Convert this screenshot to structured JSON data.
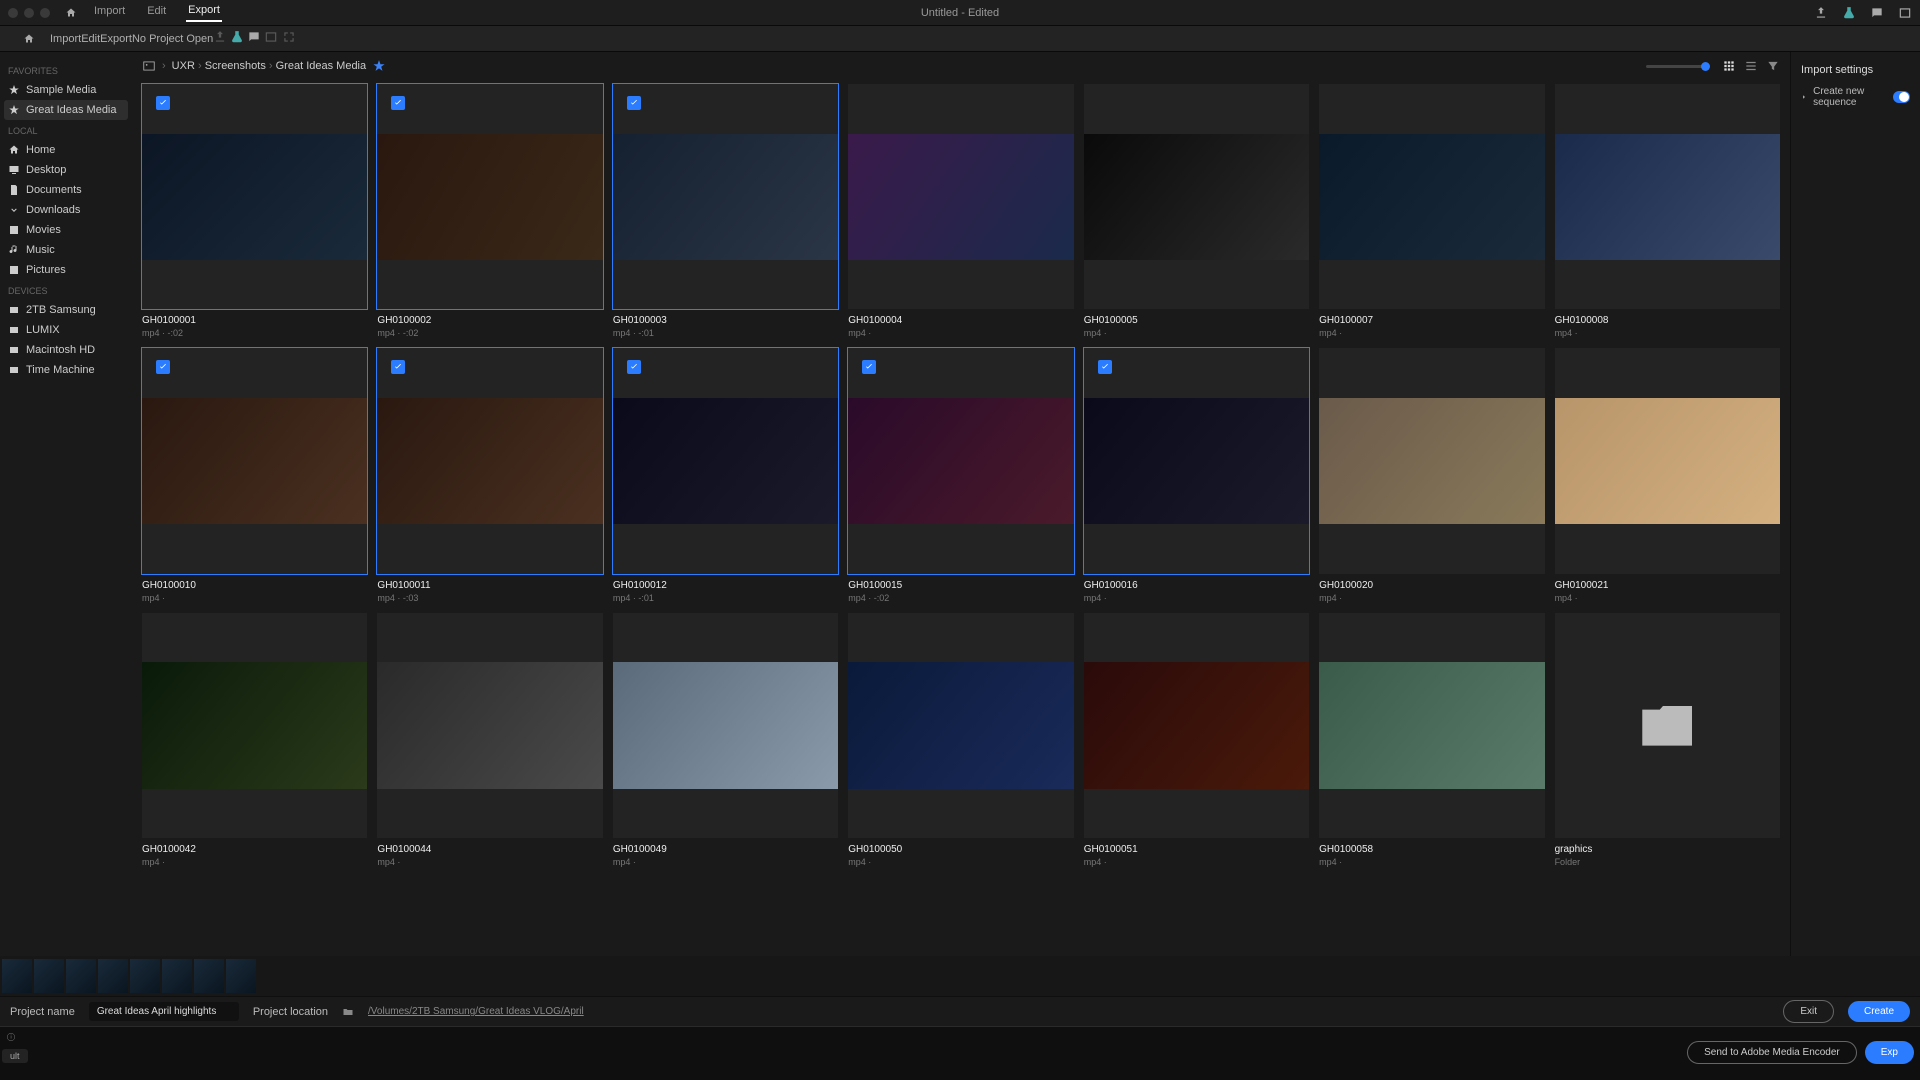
{
  "titlebar1": {
    "tabs": [
      "Import",
      "Edit",
      "Export"
    ],
    "active_index": 2,
    "center": "Untitled - Edited"
  },
  "titlebar2": {
    "tabs": [
      "Import",
      "Edit",
      "Export"
    ],
    "active_index": 0,
    "center": "No Project Open"
  },
  "sidebar": {
    "sections": [
      {
        "label": "FAVORITES",
        "items": [
          {
            "icon": "star",
            "label": "Sample Media"
          },
          {
            "icon": "star",
            "label": "Great Ideas Media",
            "active": true
          }
        ]
      },
      {
        "label": "LOCAL",
        "items": [
          {
            "icon": "home",
            "label": "Home"
          },
          {
            "icon": "desktop",
            "label": "Desktop"
          },
          {
            "icon": "doc",
            "label": "Documents"
          },
          {
            "icon": "download",
            "label": "Downloads"
          },
          {
            "icon": "movie",
            "label": "Movies"
          },
          {
            "icon": "music",
            "label": "Music"
          },
          {
            "icon": "picture",
            "label": "Pictures"
          }
        ]
      },
      {
        "label": "DEVICES",
        "items": [
          {
            "icon": "drive",
            "label": "2TB Samsung"
          },
          {
            "icon": "drive",
            "label": "LUMIX"
          },
          {
            "icon": "drive",
            "label": "Macintosh HD"
          },
          {
            "icon": "drive",
            "label": "Time Machine"
          }
        ]
      }
    ]
  },
  "breadcrumb": [
    "UXR",
    "Screenshots",
    "Great Ideas Media"
  ],
  "clips": [
    {
      "name": "GH0100001",
      "meta": "mp4 · -:02",
      "selected": true,
      "c": "c1"
    },
    {
      "name": "GH0100002",
      "meta": "mp4 · -:02",
      "selected": true,
      "c": "c2"
    },
    {
      "name": "GH0100003",
      "meta": "mp4 · -:01",
      "selected": true,
      "c": "c3"
    },
    {
      "name": "GH0100004",
      "meta": "mp4 ·",
      "selected": false,
      "c": "c4"
    },
    {
      "name": "GH0100005",
      "meta": "mp4 ·",
      "selected": false,
      "c": "c5"
    },
    {
      "name": "GH0100007",
      "meta": "mp4 ·",
      "selected": false,
      "c": "c6"
    },
    {
      "name": "GH0100008",
      "meta": "mp4 ·",
      "selected": false,
      "c": "c7"
    },
    {
      "name": "GH0100010",
      "meta": "mp4 ·",
      "selected": true,
      "c": "c8"
    },
    {
      "name": "GH0100011",
      "meta": "mp4 · -:03",
      "selected": true,
      "c": "c8"
    },
    {
      "name": "GH0100012",
      "meta": "mp4 · -:01",
      "selected": true,
      "c": "c9"
    },
    {
      "name": "GH0100015",
      "meta": "mp4 · -:02",
      "selected": true,
      "c": "c10"
    },
    {
      "name": "GH0100016",
      "meta": "mp4 ·",
      "selected": true,
      "c": "c9"
    },
    {
      "name": "GH0100020",
      "meta": "mp4 ·",
      "selected": false,
      "c": "c11"
    },
    {
      "name": "GH0100021",
      "meta": "mp4 ·",
      "selected": false,
      "c": "c12"
    },
    {
      "name": "GH0100042",
      "meta": "mp4 ·",
      "selected": false,
      "c": "c13"
    },
    {
      "name": "GH0100044",
      "meta": "mp4 ·",
      "selected": false,
      "c": "c14"
    },
    {
      "name": "GH0100049",
      "meta": "mp4 ·",
      "selected": false,
      "c": "c15"
    },
    {
      "name": "GH0100050",
      "meta": "mp4 ·",
      "selected": false,
      "c": "c16"
    },
    {
      "name": "GH0100051",
      "meta": "mp4 ·",
      "selected": false,
      "c": "c17"
    },
    {
      "name": "GH0100058",
      "meta": "mp4 ·",
      "selected": false,
      "c": "c18"
    },
    {
      "name": "graphics",
      "meta": "Folder",
      "selected": false,
      "folder": true
    }
  ],
  "right_panel": {
    "title": "Import settings",
    "row1": "Create new sequence"
  },
  "project_bar": {
    "name_label": "Project name",
    "name_value": "Great Ideas April highlights",
    "loc_label": "Project location",
    "loc_path": "/Volumes/2TB Samsung/Great Ideas VLOG/April",
    "exit": "Exit",
    "create": "Create"
  },
  "bottom_bar": {
    "small": "ult",
    "encoder": "Send to Adobe Media Encoder",
    "export": "Exp"
  },
  "strip_count": 8
}
